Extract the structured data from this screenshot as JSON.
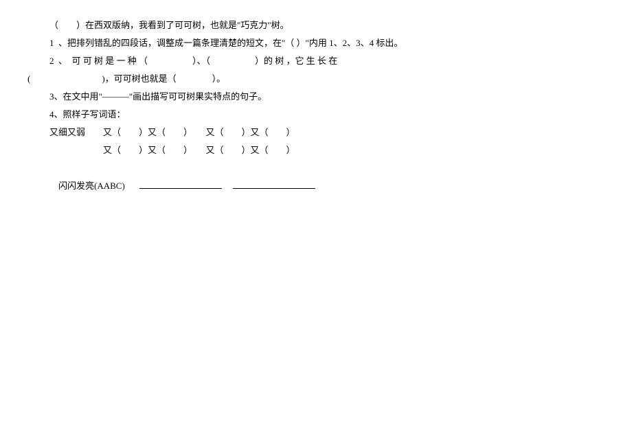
{
  "para0": "（　　）在西双版纳，我看到了可可树，也就是\"巧克力\"树。",
  "q1": "1  、把排列错乱的四段话，调整成一篇条理清楚的短文，在\"（ ）\"内用 1、2、3、4 标出。",
  "q2_part1": "2  、  可 可 树 是 一 种 （　　　　　）、（　　　　　）的 树 ，它 生 长 在",
  "q2_part2": "(　　　　　　　　)，可可树也就是（　　　　）。",
  "q3": "3、在文中用\"———\"画出描写可可树果实特点的句子。",
  "q4": "4、照样子写词语：",
  "line4a": "又细又弱　　又（　　）又（　　）　　又（　　）又（　　）",
  "line4b": "　　　　　　又（　　）又（　　）　　又（　　）又（　　）",
  "line4c_prefix": "闪闪发亮(AABC)　"
}
